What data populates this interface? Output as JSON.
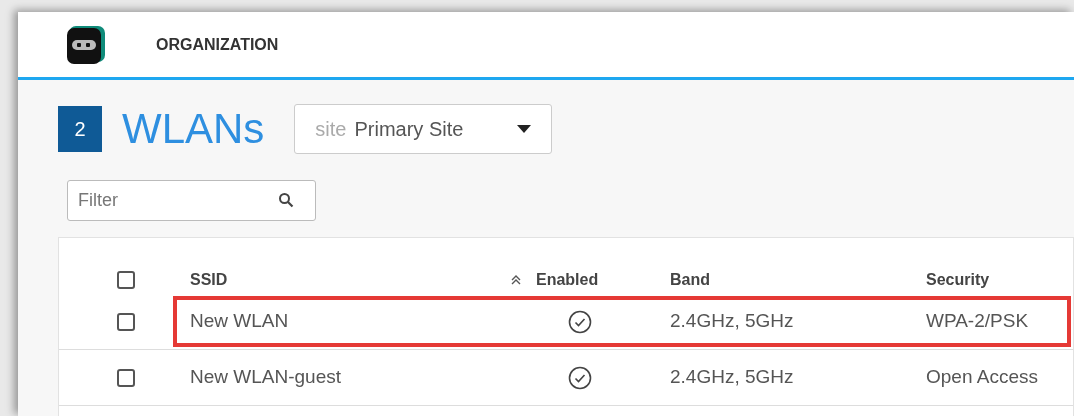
{
  "header": {
    "title": "ORGANIZATION"
  },
  "page": {
    "count": "2",
    "title": "WLANs",
    "site_label": "site",
    "site_value": "Primary Site"
  },
  "filter": {
    "placeholder": "Filter"
  },
  "table": {
    "select_all_checked": false,
    "columns": [
      "SSID",
      "Enabled",
      "Band",
      "Security"
    ],
    "rows": [
      {
        "checked": false,
        "highlighted": true,
        "ssid": "New WLAN",
        "enabled": true,
        "band": "2.4GHz, 5GHz",
        "security": "WPA-2/PSK"
      },
      {
        "checked": false,
        "highlighted": false,
        "ssid": "New WLAN-guest",
        "enabled": true,
        "band": "2.4GHz, 5GHz",
        "security": "Open Access"
      }
    ]
  }
}
